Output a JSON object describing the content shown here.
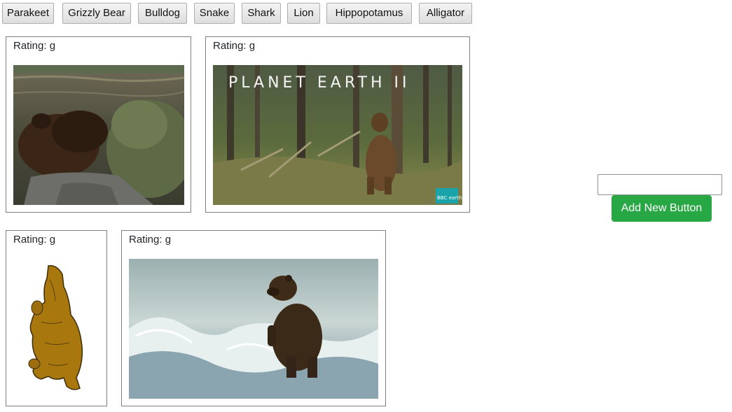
{
  "topbar": {
    "buttons": [
      "Parakeet",
      "Grizzly Bear",
      "Bulldog",
      "Snake",
      "Shark",
      "Lion",
      "Hippopotamus",
      "Alligator"
    ]
  },
  "gifs": [
    {
      "rating": "Rating: g",
      "image": "bear-behind-person-gif"
    },
    {
      "rating": "Rating: g",
      "image": "planet-earth-bear-tree-gif",
      "overlay_title": "PLANET EARTH II",
      "overlay_badge": "BBC earth"
    },
    {
      "rating": "Rating: g",
      "image": "cartoon-dancing-bear-gif"
    },
    {
      "rating": "Rating: g",
      "image": "bear-in-river-gif"
    }
  ],
  "form": {
    "input_value": "",
    "input_placeholder": "",
    "add_button": "Add New Button"
  },
  "colors": {
    "add_button": "#28a745",
    "card_border": "#7f7f7f"
  }
}
